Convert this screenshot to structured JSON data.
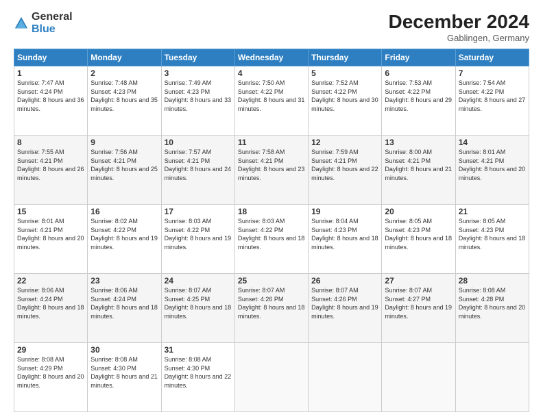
{
  "header": {
    "logo_general": "General",
    "logo_blue": "Blue",
    "title": "December 2024",
    "subtitle": "Gablingen, Germany"
  },
  "weekdays": [
    "Sunday",
    "Monday",
    "Tuesday",
    "Wednesday",
    "Thursday",
    "Friday",
    "Saturday"
  ],
  "weeks": [
    [
      {
        "day": "1",
        "sunrise": "Sunrise: 7:47 AM",
        "sunset": "Sunset: 4:24 PM",
        "daylight": "Daylight: 8 hours and 36 minutes."
      },
      {
        "day": "2",
        "sunrise": "Sunrise: 7:48 AM",
        "sunset": "Sunset: 4:23 PM",
        "daylight": "Daylight: 8 hours and 35 minutes."
      },
      {
        "day": "3",
        "sunrise": "Sunrise: 7:49 AM",
        "sunset": "Sunset: 4:23 PM",
        "daylight": "Daylight: 8 hours and 33 minutes."
      },
      {
        "day": "4",
        "sunrise": "Sunrise: 7:50 AM",
        "sunset": "Sunset: 4:22 PM",
        "daylight": "Daylight: 8 hours and 31 minutes."
      },
      {
        "day": "5",
        "sunrise": "Sunrise: 7:52 AM",
        "sunset": "Sunset: 4:22 PM",
        "daylight": "Daylight: 8 hours and 30 minutes."
      },
      {
        "day": "6",
        "sunrise": "Sunrise: 7:53 AM",
        "sunset": "Sunset: 4:22 PM",
        "daylight": "Daylight: 8 hours and 29 minutes."
      },
      {
        "day": "7",
        "sunrise": "Sunrise: 7:54 AM",
        "sunset": "Sunset: 4:22 PM",
        "daylight": "Daylight: 8 hours and 27 minutes."
      }
    ],
    [
      {
        "day": "8",
        "sunrise": "Sunrise: 7:55 AM",
        "sunset": "Sunset: 4:21 PM",
        "daylight": "Daylight: 8 hours and 26 minutes."
      },
      {
        "day": "9",
        "sunrise": "Sunrise: 7:56 AM",
        "sunset": "Sunset: 4:21 PM",
        "daylight": "Daylight: 8 hours and 25 minutes."
      },
      {
        "day": "10",
        "sunrise": "Sunrise: 7:57 AM",
        "sunset": "Sunset: 4:21 PM",
        "daylight": "Daylight: 8 hours and 24 minutes."
      },
      {
        "day": "11",
        "sunrise": "Sunrise: 7:58 AM",
        "sunset": "Sunset: 4:21 PM",
        "daylight": "Daylight: 8 hours and 23 minutes."
      },
      {
        "day": "12",
        "sunrise": "Sunrise: 7:59 AM",
        "sunset": "Sunset: 4:21 PM",
        "daylight": "Daylight: 8 hours and 22 minutes."
      },
      {
        "day": "13",
        "sunrise": "Sunrise: 8:00 AM",
        "sunset": "Sunset: 4:21 PM",
        "daylight": "Daylight: 8 hours and 21 minutes."
      },
      {
        "day": "14",
        "sunrise": "Sunrise: 8:01 AM",
        "sunset": "Sunset: 4:21 PM",
        "daylight": "Daylight: 8 hours and 20 minutes."
      }
    ],
    [
      {
        "day": "15",
        "sunrise": "Sunrise: 8:01 AM",
        "sunset": "Sunset: 4:21 PM",
        "daylight": "Daylight: 8 hours and 20 minutes."
      },
      {
        "day": "16",
        "sunrise": "Sunrise: 8:02 AM",
        "sunset": "Sunset: 4:22 PM",
        "daylight": "Daylight: 8 hours and 19 minutes."
      },
      {
        "day": "17",
        "sunrise": "Sunrise: 8:03 AM",
        "sunset": "Sunset: 4:22 PM",
        "daylight": "Daylight: 8 hours and 19 minutes."
      },
      {
        "day": "18",
        "sunrise": "Sunrise: 8:03 AM",
        "sunset": "Sunset: 4:22 PM",
        "daylight": "Daylight: 8 hours and 18 minutes."
      },
      {
        "day": "19",
        "sunrise": "Sunrise: 8:04 AM",
        "sunset": "Sunset: 4:23 PM",
        "daylight": "Daylight: 8 hours and 18 minutes."
      },
      {
        "day": "20",
        "sunrise": "Sunrise: 8:05 AM",
        "sunset": "Sunset: 4:23 PM",
        "daylight": "Daylight: 8 hours and 18 minutes."
      },
      {
        "day": "21",
        "sunrise": "Sunrise: 8:05 AM",
        "sunset": "Sunset: 4:23 PM",
        "daylight": "Daylight: 8 hours and 18 minutes."
      }
    ],
    [
      {
        "day": "22",
        "sunrise": "Sunrise: 8:06 AM",
        "sunset": "Sunset: 4:24 PM",
        "daylight": "Daylight: 8 hours and 18 minutes."
      },
      {
        "day": "23",
        "sunrise": "Sunrise: 8:06 AM",
        "sunset": "Sunset: 4:24 PM",
        "daylight": "Daylight: 8 hours and 18 minutes."
      },
      {
        "day": "24",
        "sunrise": "Sunrise: 8:07 AM",
        "sunset": "Sunset: 4:25 PM",
        "daylight": "Daylight: 8 hours and 18 minutes."
      },
      {
        "day": "25",
        "sunrise": "Sunrise: 8:07 AM",
        "sunset": "Sunset: 4:26 PM",
        "daylight": "Daylight: 8 hours and 18 minutes."
      },
      {
        "day": "26",
        "sunrise": "Sunrise: 8:07 AM",
        "sunset": "Sunset: 4:26 PM",
        "daylight": "Daylight: 8 hours and 19 minutes."
      },
      {
        "day": "27",
        "sunrise": "Sunrise: 8:07 AM",
        "sunset": "Sunset: 4:27 PM",
        "daylight": "Daylight: 8 hours and 19 minutes."
      },
      {
        "day": "28",
        "sunrise": "Sunrise: 8:08 AM",
        "sunset": "Sunset: 4:28 PM",
        "daylight": "Daylight: 8 hours and 20 minutes."
      }
    ],
    [
      {
        "day": "29",
        "sunrise": "Sunrise: 8:08 AM",
        "sunset": "Sunset: 4:29 PM",
        "daylight": "Daylight: 8 hours and 20 minutes."
      },
      {
        "day": "30",
        "sunrise": "Sunrise: 8:08 AM",
        "sunset": "Sunset: 4:30 PM",
        "daylight": "Daylight: 8 hours and 21 minutes."
      },
      {
        "day": "31",
        "sunrise": "Sunrise: 8:08 AM",
        "sunset": "Sunset: 4:30 PM",
        "daylight": "Daylight: 8 hours and 22 minutes."
      },
      null,
      null,
      null,
      null
    ]
  ]
}
